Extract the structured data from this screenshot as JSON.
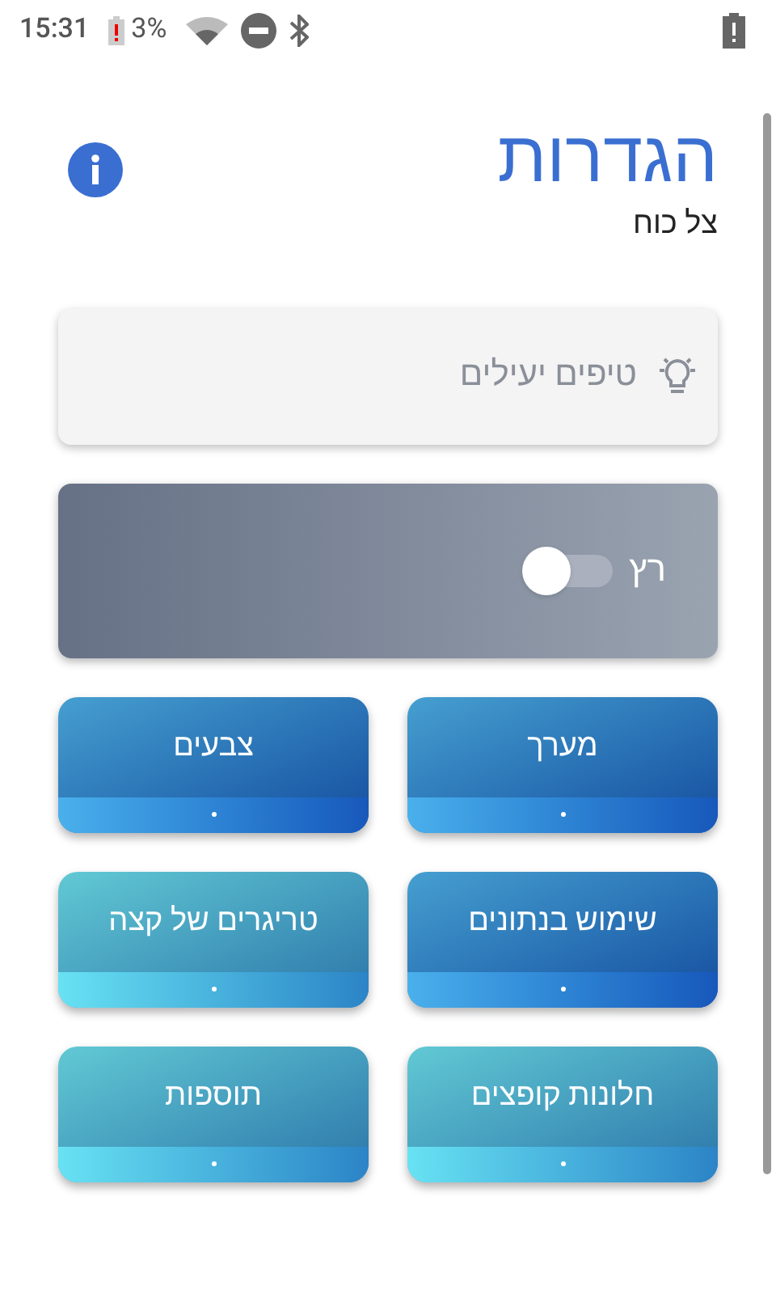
{
  "status_bar": {
    "time": "15:31",
    "battery": "3%"
  },
  "header": {
    "title": "הגדרות",
    "subtitle": "צל כוח"
  },
  "tips": {
    "label": "טיפים יעילים"
  },
  "run_toggle": {
    "label": "רץ",
    "on": false
  },
  "tiles": [
    {
      "label": "מערך",
      "kind": "blue"
    },
    {
      "label": "צבעים",
      "kind": "blue"
    },
    {
      "label": "שימוש בנתונים",
      "kind": "blue"
    },
    {
      "label": "טריגרים של קצה",
      "kind": "teal"
    },
    {
      "label": "חלונות קופצים",
      "kind": "teal"
    },
    {
      "label": "תוספות",
      "kind": "teal"
    }
  ]
}
